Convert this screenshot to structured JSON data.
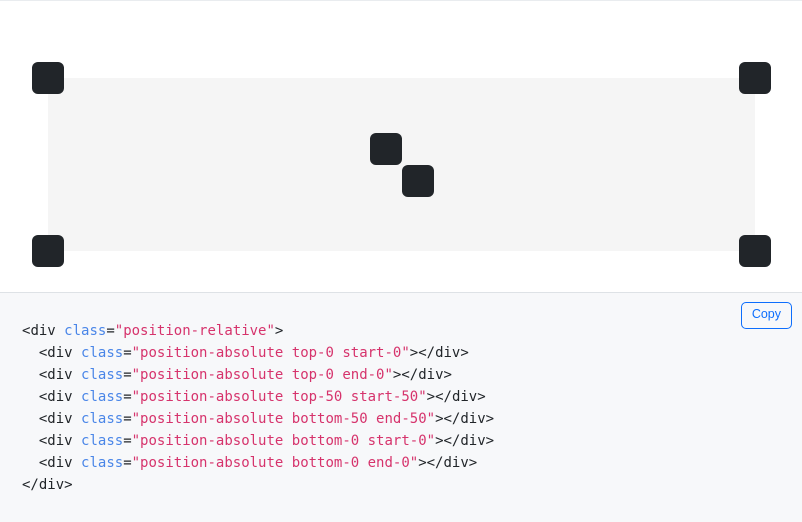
{
  "preview": {
    "container_class": "position-relative",
    "container_bg": "#f5f5f5",
    "square_color": "#212529",
    "squares": [
      {
        "name": "top-0 start-0",
        "label": "top-0 start-0"
      },
      {
        "name": "top-0 end-0",
        "label": "top-0 end-0"
      },
      {
        "name": "top-50 start-50",
        "label": "top-50 start-50"
      },
      {
        "name": "bottom-50 end-50",
        "label": "bottom-50 end-50"
      },
      {
        "name": "bottom-0 start-0",
        "label": "bottom-0 start-0"
      },
      {
        "name": "bottom-0 end-0",
        "label": "bottom-0 end-0"
      }
    ]
  },
  "code_panel": {
    "copy_label": "Copy",
    "accent_color": "#0d6efd",
    "background": "#f7f8fa",
    "language": "html",
    "lines": [
      {
        "indent": "",
        "segments": [
          {
            "t": "punct",
            "v": "<"
          },
          {
            "t": "tag",
            "v": "div"
          },
          {
            "t": "punct",
            "v": " "
          },
          {
            "t": "attr",
            "v": "class"
          },
          {
            "t": "eq",
            "v": "="
          },
          {
            "t": "str",
            "v": "\"position-relative\""
          },
          {
            "t": "punct",
            "v": ">"
          }
        ]
      },
      {
        "indent": "  ",
        "segments": [
          {
            "t": "punct",
            "v": "<"
          },
          {
            "t": "tag",
            "v": "div"
          },
          {
            "t": "punct",
            "v": " "
          },
          {
            "t": "attr",
            "v": "class"
          },
          {
            "t": "eq",
            "v": "="
          },
          {
            "t": "str",
            "v": "\"position-absolute top-0 start-0\""
          },
          {
            "t": "punct",
            "v": "></"
          },
          {
            "t": "tag",
            "v": "div"
          },
          {
            "t": "punct",
            "v": ">"
          }
        ]
      },
      {
        "indent": "  ",
        "segments": [
          {
            "t": "punct",
            "v": "<"
          },
          {
            "t": "tag",
            "v": "div"
          },
          {
            "t": "punct",
            "v": " "
          },
          {
            "t": "attr",
            "v": "class"
          },
          {
            "t": "eq",
            "v": "="
          },
          {
            "t": "str",
            "v": "\"position-absolute top-0 end-0\""
          },
          {
            "t": "punct",
            "v": "></"
          },
          {
            "t": "tag",
            "v": "div"
          },
          {
            "t": "punct",
            "v": ">"
          }
        ]
      },
      {
        "indent": "  ",
        "segments": [
          {
            "t": "punct",
            "v": "<"
          },
          {
            "t": "tag",
            "v": "div"
          },
          {
            "t": "punct",
            "v": " "
          },
          {
            "t": "attr",
            "v": "class"
          },
          {
            "t": "eq",
            "v": "="
          },
          {
            "t": "str",
            "v": "\"position-absolute top-50 start-50\""
          },
          {
            "t": "punct",
            "v": "></"
          },
          {
            "t": "tag",
            "v": "div"
          },
          {
            "t": "punct",
            "v": ">"
          }
        ]
      },
      {
        "indent": "  ",
        "segments": [
          {
            "t": "punct",
            "v": "<"
          },
          {
            "t": "tag",
            "v": "div"
          },
          {
            "t": "punct",
            "v": " "
          },
          {
            "t": "attr",
            "v": "class"
          },
          {
            "t": "eq",
            "v": "="
          },
          {
            "t": "str",
            "v": "\"position-absolute bottom-50 end-50\""
          },
          {
            "t": "punct",
            "v": "></"
          },
          {
            "t": "tag",
            "v": "div"
          },
          {
            "t": "punct",
            "v": ">"
          }
        ]
      },
      {
        "indent": "  ",
        "segments": [
          {
            "t": "punct",
            "v": "<"
          },
          {
            "t": "tag",
            "v": "div"
          },
          {
            "t": "punct",
            "v": " "
          },
          {
            "t": "attr",
            "v": "class"
          },
          {
            "t": "eq",
            "v": "="
          },
          {
            "t": "str",
            "v": "\"position-absolute bottom-0 start-0\""
          },
          {
            "t": "punct",
            "v": "></"
          },
          {
            "t": "tag",
            "v": "div"
          },
          {
            "t": "punct",
            "v": ">"
          }
        ]
      },
      {
        "indent": "  ",
        "segments": [
          {
            "t": "punct",
            "v": "<"
          },
          {
            "t": "tag",
            "v": "div"
          },
          {
            "t": "punct",
            "v": " "
          },
          {
            "t": "attr",
            "v": "class"
          },
          {
            "t": "eq",
            "v": "="
          },
          {
            "t": "str",
            "v": "\"position-absolute bottom-0 end-0\""
          },
          {
            "t": "punct",
            "v": "></"
          },
          {
            "t": "tag",
            "v": "div"
          },
          {
            "t": "punct",
            "v": ">"
          }
        ]
      },
      {
        "indent": "",
        "segments": [
          {
            "t": "punct",
            "v": "</"
          },
          {
            "t": "tag",
            "v": "div"
          },
          {
            "t": "punct",
            "v": ">"
          }
        ]
      }
    ]
  }
}
